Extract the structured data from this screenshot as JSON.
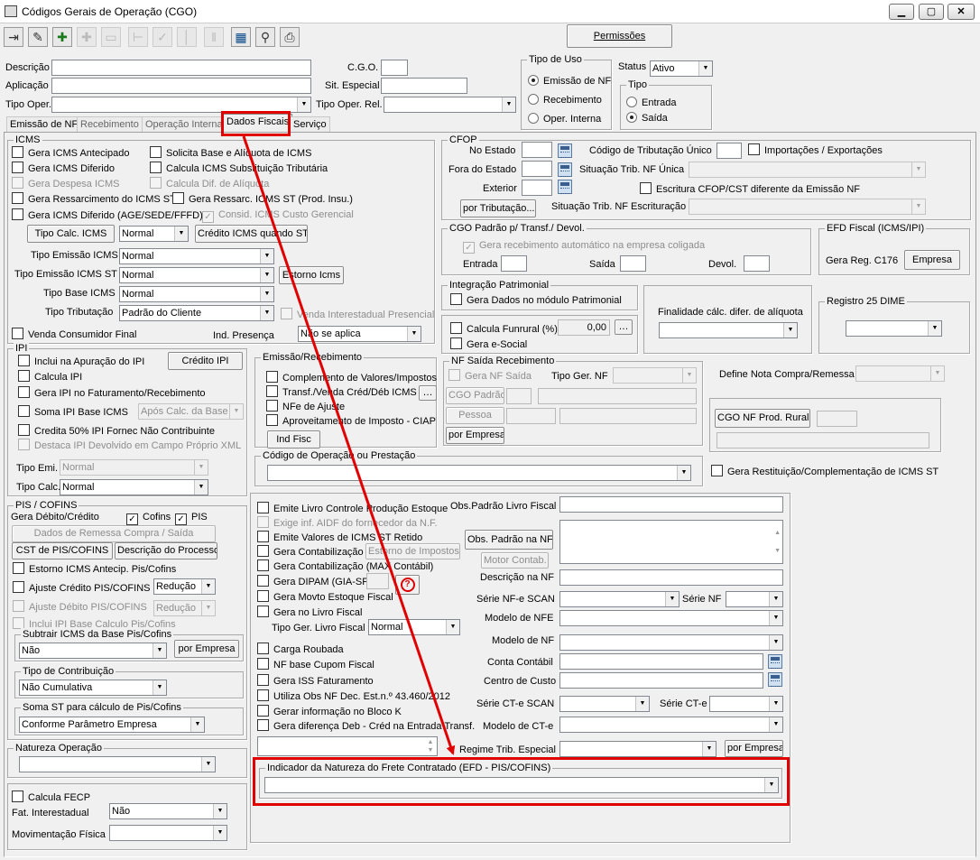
{
  "window": {
    "title": "Códigos Gerais de Operação (CGO)"
  },
  "toolbar": {
    "icons": [
      "exit-icon",
      "eraser-icon",
      "add-icon",
      "expand-icon",
      "collapse-icon",
      "first-icon",
      "check-icon",
      "divider-icon",
      "pause-icon",
      "grid-icon",
      "binoculars-icon",
      "print-icon"
    ],
    "permissions_label": "Permissões"
  },
  "top": {
    "descricao_label": "Descrição",
    "aplicacao_label": "Aplicação",
    "tipo_oper_label": "Tipo Oper.",
    "cgo_label": "C.G.O.",
    "sit_especial_label": "Sit. Especial",
    "tipo_oper_rel_label": "Tipo Oper. Rel.",
    "tipo_uso": {
      "title": "Tipo de Uso",
      "options": [
        "Emissão de NF",
        "Recebimento",
        "Oper. Interna"
      ],
      "selected": "Emissão de NF"
    },
    "status_label": "Status",
    "status_value": "Ativo",
    "tipo": {
      "title": "Tipo",
      "options": [
        "Entrada",
        "Saída"
      ],
      "selected": "Saída"
    }
  },
  "tabs": [
    "Emissão de NF",
    "Recebimento",
    "Operação Interna",
    "Dados Fiscais",
    "Serviço"
  ],
  "icms": {
    "title": "ICMS",
    "checks": [
      "Gera ICMS Antecipado",
      "Gera ICMS Diferido",
      "Gera Despesa ICMS",
      "Gera Ressarcimento do ICMS ST",
      "Gera ICMS Diferido (AGE/SEDE/FFFD)",
      "Solicita Base e Alíquota de ICMS",
      "Calcula ICMS Substituição Tributária",
      "Calcula Dif. de Alíquota",
      "Gera Ressarc. ICMS ST (Prod. Insu.)",
      "Consid. ICMS Custo Gerencial"
    ],
    "tipo_calc_button": "Tipo Calc. ICMS",
    "tipo_calc_value": "Normal",
    "credito_button": "Crédito ICMS quando ST",
    "tipo_emissao_label": "Tipo Emissão ICMS",
    "tipo_emissao_value": "Normal",
    "tipo_emissao_st_label": "Tipo Emissão ICMS ST",
    "tipo_emissao_st_value": "Normal",
    "estorno_button": "Estorno Icms",
    "tipo_base_label": "Tipo Base ICMS",
    "tipo_base_value": "Normal",
    "tipo_tributacao_label": "Tipo Tributação",
    "tipo_tributacao_value": "Padrão do Cliente",
    "venda_interestadual": "Venda Interestadual Presencial",
    "venda_consumidor": "Venda Consumidor Final",
    "ind_presenca_label": "Ind. Presença",
    "ind_presenca_value": "Não se aplica"
  },
  "cfop": {
    "title": "CFOP",
    "no_estado": "No Estado",
    "fora_estado": "Fora do Estado",
    "exterior": "Exterior",
    "por_tributacao": "por Tributação...",
    "cod_trib_unico": "Código de Tributação Único",
    "importacoes": "Importações / Exportações",
    "sit_trib_unica": "Situação Trib. NF Única",
    "escrituracao": "Escritura CFOP/CST diferente da Emissão NF",
    "sit_trib_escrituracao": "Situação Trib. NF Escrituração"
  },
  "cgo_padrao": {
    "title": "CGO Padrão p/ Transf./ Devol.",
    "gera_recebimento": "Gera recebimento automático na empresa coligada",
    "entrada": "Entrada",
    "saida": "Saída",
    "devol": "Devol."
  },
  "efd": {
    "title": "EFD Fiscal (ICMS/IPI)",
    "gera_reg": "Gera Reg. C176",
    "empresa_button": "Empresa"
  },
  "integracao": {
    "title": "Integração Patrimonial",
    "gera_dados": "Gera Dados no módulo Patrimonial"
  },
  "funrural": {
    "calcula": "Calcula Funrural (%)",
    "value": "0,00",
    "gera_esocial": "Gera e-Social"
  },
  "finalidade_label": "Finalidade cálc. difer. de alíquota",
  "registro25": {
    "title": "Registro 25 DIME"
  },
  "ipi": {
    "title": "IPI",
    "checks": [
      "Inclui na Apuração do IPI",
      "Calcula IPI",
      "Gera IPI no Faturamento/Recebimento",
      "Soma IPI Base ICMS",
      "Credita 50% IPI Fornec Não Contribuinte",
      "Destaca IPI Devolvido em Campo Próprio XML"
    ],
    "credito_button": "Crédito IPI",
    "apos_calc": "Após Calc. da Base",
    "tipo_emi_label": "Tipo Emi.",
    "tipo_emi_value": "Normal",
    "tipo_calc_label": "Tipo Calc.",
    "tipo_calc_value": "Normal"
  },
  "emissao": {
    "title": "Emissão/Recebimento",
    "checks": [
      "Complemento de Valores/Impostos",
      "Transf./Venda Créd/Déb ICMS",
      "NFe de Ajuste",
      "Aproveitamento de Imposto - CIAP"
    ],
    "ind_fisc": "Ind Fisc"
  },
  "nf_saida": {
    "title": "NF Saída Recebimento",
    "gera_nf_saida": "Gera NF Saída",
    "tipo_ger_nf": "Tipo Ger. NF",
    "cgo_padrao": "CGO Padrão",
    "pessoa": "Pessoa",
    "por_empresa": "por Empresa"
  },
  "define_nota_label": "Define Nota Compra/Remessa",
  "cgo_nf_prod_rural": "CGO NF Prod. Rural",
  "codigo_operacao": {
    "title": "Código de Operação ou Prestação"
  },
  "gera_restituicao": "Gera Restituição/Complementação de ICMS ST",
  "pis": {
    "title": "PIS / COFINS",
    "gera_debito": "Gera Débito/Crédito",
    "cofins": "Cofins",
    "pis": "PIS",
    "dados_remessa": "Dados de Remessa Compra / Saída",
    "cst_button": "CST de PIS/COFINS",
    "descricao_button": "Descrição do Processo",
    "estorno": "Estorno ICMS Antecip. Pis/Cofins",
    "ajuste_credito": "Ajuste Crédito PIS/COFINS",
    "ajuste_debito": "Ajuste Débito PIS/COFINS",
    "reducao": "Redução",
    "inclui_ipi": "Inclui IPI Base Calculo Pis/Cofins"
  },
  "subtrair": {
    "title": "Subtrair ICMS da Base Pis/Cofins",
    "value": "Não",
    "por_empresa": "por Empresa"
  },
  "tipo_contribuicao": {
    "title": "Tipo de Contribuição",
    "value": "Não Cumulativa"
  },
  "soma_st": {
    "title": "Soma ST para cálculo de Pis/Cofins",
    "value": "Conforme Parâmetro Empresa"
  },
  "natureza": {
    "title": "Natureza Operação"
  },
  "fecp": {
    "calcula": "Calcula FECP",
    "fat_label": "Fat. Interestadual",
    "fat_value": "Não",
    "mov_label": "Movimentação Física"
  },
  "livro": {
    "checks": [
      "Emite Livro Controle Produção Estoque",
      "Exige inf. AIDF do fornecedor da N.F.",
      "Emite Valores de ICMS ST Retido",
      "Gera Contabilização",
      "Gera Contabilização (MAX Contábil)",
      "Gera DIPAM (GIA-SP)",
      "Gera Movto Estoque Fiscal",
      "Gera no Livro Fiscal",
      "Carga Roubada",
      "NF base Cupom Fiscal",
      "Gera ISS Faturamento",
      "Utiliza Obs NF Dec. Est.n.º 43.460/2012",
      "Gerar informação no Bloco K",
      "Gera diferença Deb - Créd na Entrada Transf."
    ],
    "estorno_impostos": "Estorno de Impostos",
    "tipo_ger_livro": "Tipo Ger. Livro Fiscal",
    "tipo_ger_value": "Normal",
    "help": "?"
  },
  "obs": {
    "padrao_livro": "Obs.Padrão Livro Fiscal",
    "padrao_nf_button": "Obs. Padrão na NF",
    "motor_contab": "Motor Contab.",
    "descricao_nf": "Descrição na NF",
    "serie_scan": "Série NF-e SCAN",
    "serie_nf": "Série NF",
    "modelo_nfe": "Modelo de NFE",
    "modelo_nf": "Modelo de NF",
    "conta_contabil": "Conta Contábil",
    "centro_custo": "Centro de Custo",
    "serie_cte_scan": "Série CT-e SCAN",
    "serie_cte": "Série CT-e",
    "modelo_cte": "Modelo de CT-e",
    "regime": "Regime Trib. Especial",
    "por_empresa": "por Empresa"
  },
  "indicador": {
    "title": "Indicador da Natureza do Frete Contratado (EFD - PIS/COFINS)"
  },
  "colors": {
    "highlight": "#e00000"
  }
}
